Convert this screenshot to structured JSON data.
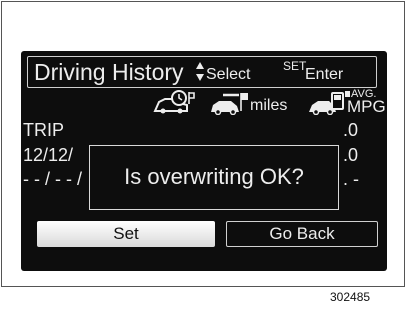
{
  "header": {
    "title": "Driving History",
    "select_label": "Select",
    "set_label": "SET",
    "enter_label": "Enter"
  },
  "columns": {
    "col2_unit": "miles",
    "col3_unit_top": "AVG.",
    "col3_unit_bottom": "MPG",
    "icons": [
      "car-clock-icon",
      "car-flag-miles-icon",
      "car-fuel-mpg-icon"
    ]
  },
  "rows": [
    {
      "label": "TRIP",
      "value": ".0"
    },
    {
      "label": "12/12/",
      "value": ".0"
    },
    {
      "label": "- - / - - /",
      "value": ". -"
    }
  ],
  "dialog": {
    "message": "Is overwriting OK?"
  },
  "buttons": {
    "set": "Set",
    "go_back": "Go Back"
  },
  "figure_code": "302485"
}
